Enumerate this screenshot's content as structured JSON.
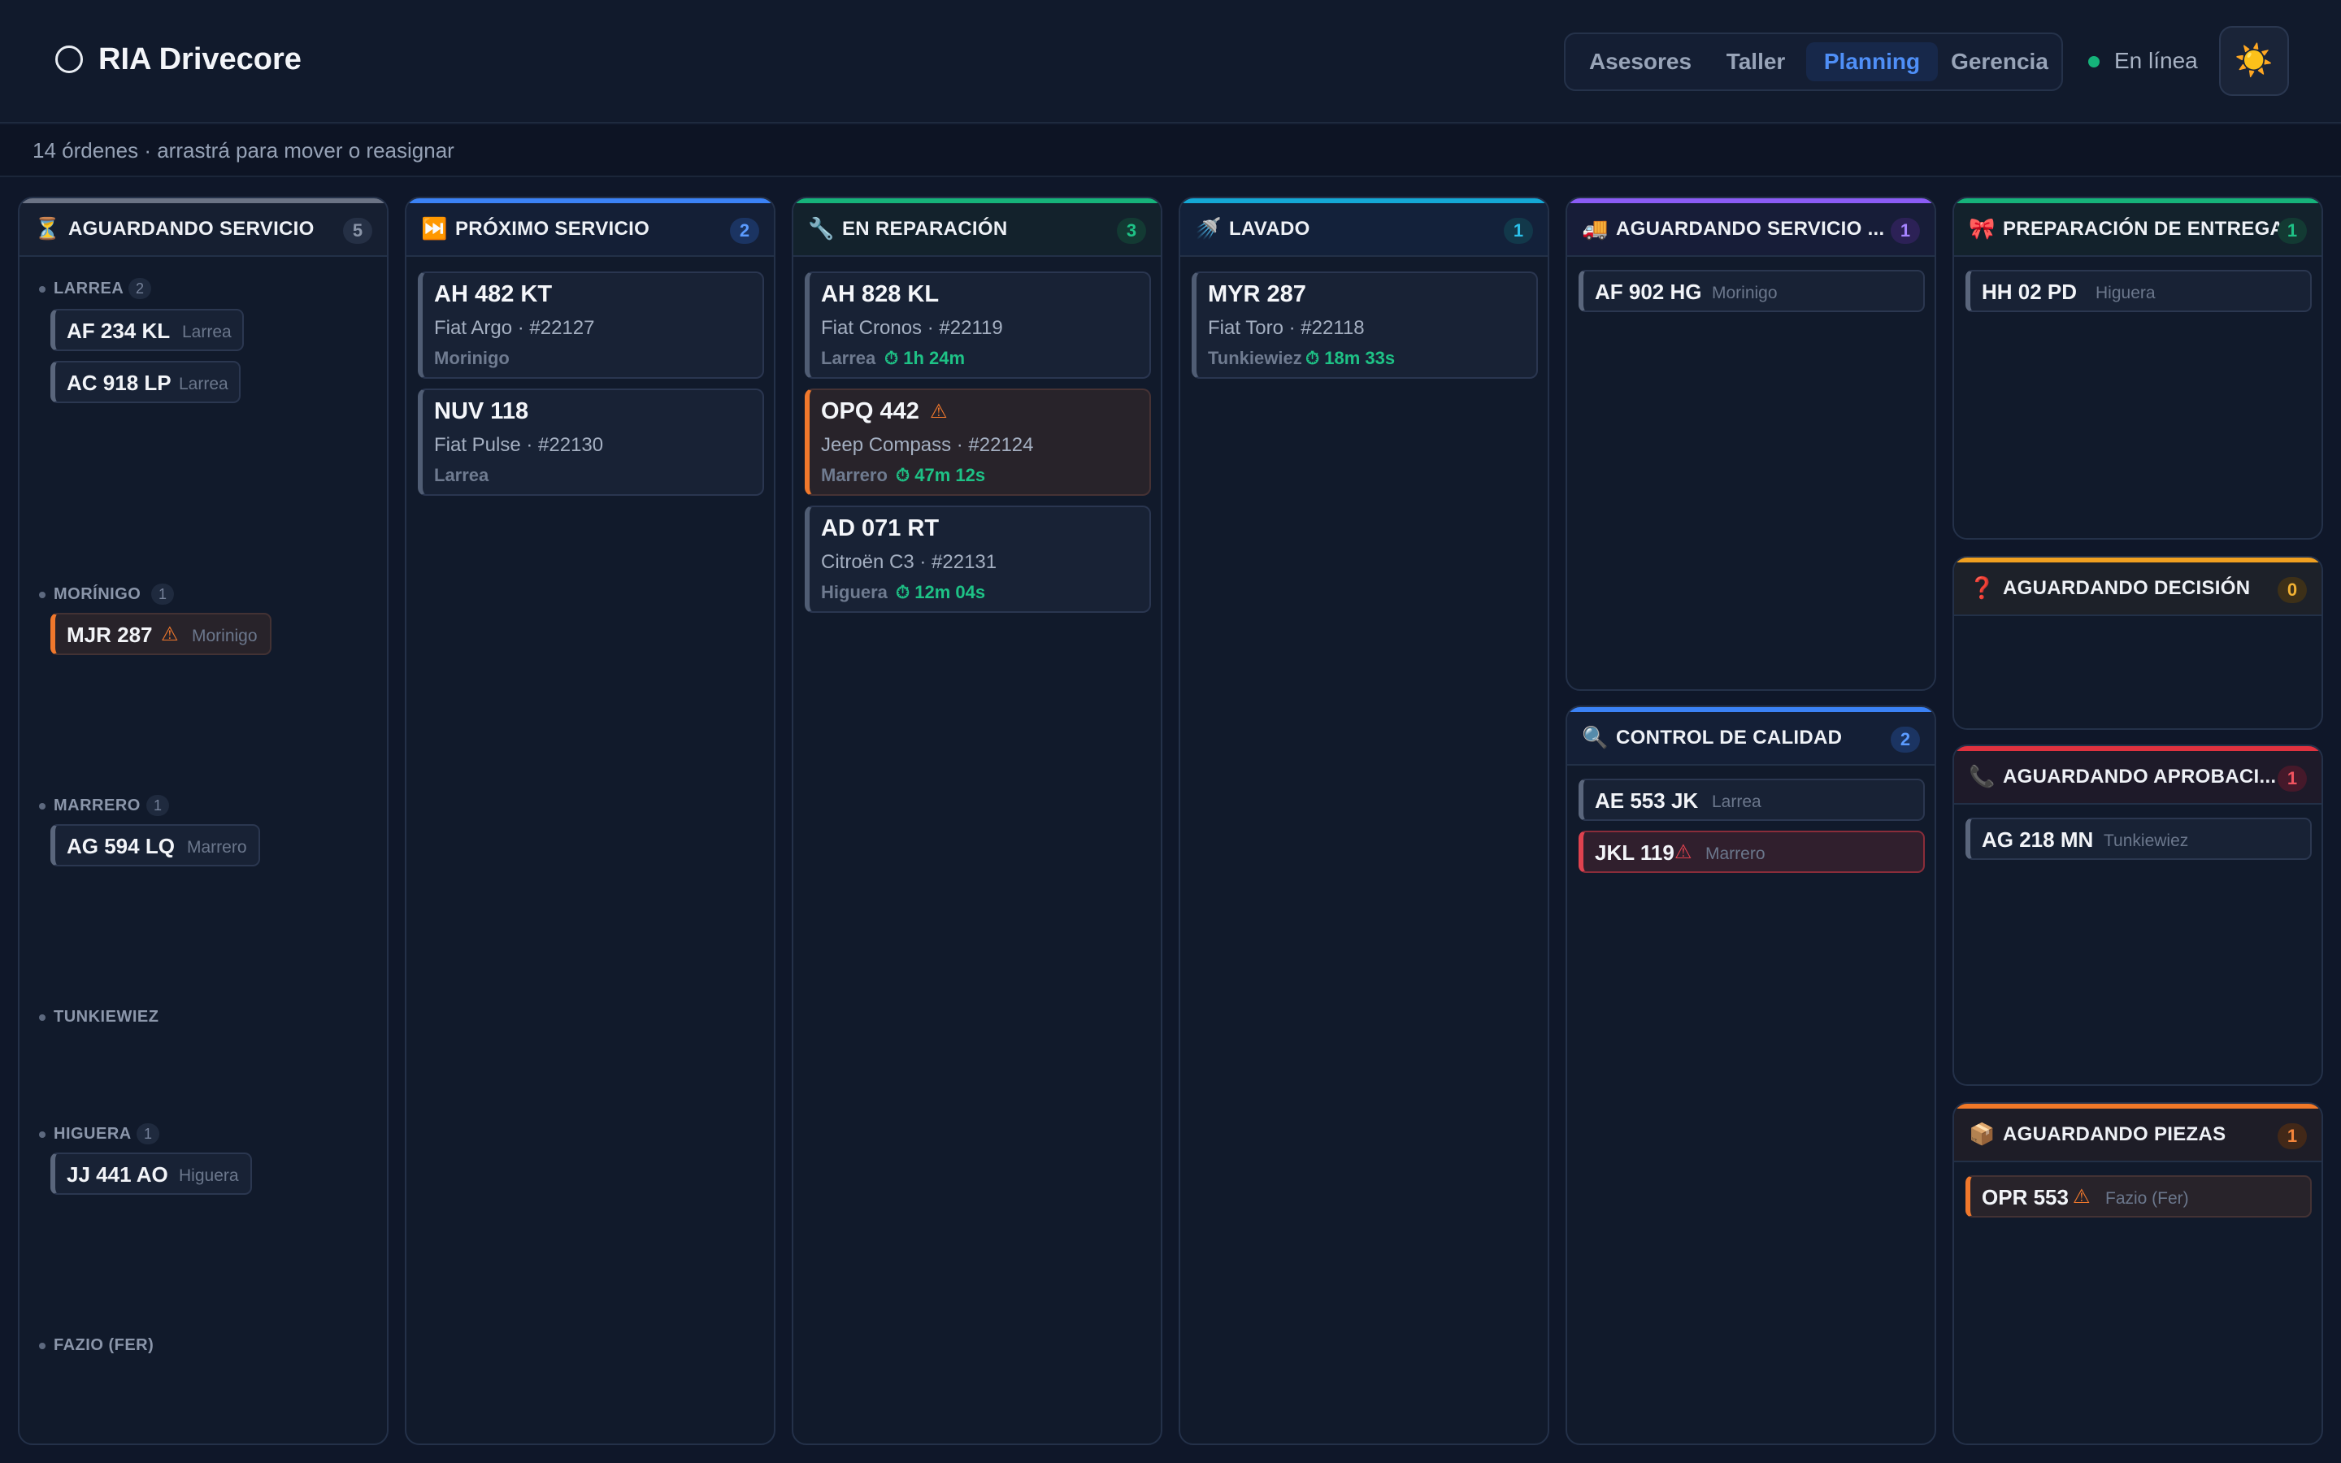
{
  "app": {
    "title": "RIA Drivecore"
  },
  "nav": {
    "tabs": [
      "Asesores",
      "Taller",
      "Planning",
      "Gerencia"
    ],
    "active": "Planning"
  },
  "status": {
    "label": "En línea",
    "color": "#15b37a"
  },
  "theme_toggle": {
    "icon": "☀️"
  },
  "subbar": {
    "text": "14 órdenes · arrastrá para mover o reasignar"
  },
  "columns": {
    "waiting": {
      "icon": "⏳",
      "title": "AGUARDANDO SERVICIO",
      "count": "5",
      "color": "#6b7385",
      "groups": [
        {
          "name": "LARREA",
          "count": "2",
          "chips": [
            {
              "plate": "AF 234 KL",
              "owner": "Larrea"
            },
            {
              "plate": "AC 918 LP",
              "owner": "Larrea"
            }
          ]
        },
        {
          "name": "MORÍNIGO",
          "count": "1",
          "chips": [
            {
              "plate": "MJR 287",
              "owner": "Morinigo",
              "warn": "⚠"
            }
          ]
        },
        {
          "name": "MARRERO",
          "count": "1",
          "chips": [
            {
              "plate": "AG 594 LQ",
              "owner": "Marrero"
            }
          ]
        },
        {
          "name": "TUNKIEWIEZ",
          "count": "",
          "chips": []
        },
        {
          "name": "HIGUERA",
          "count": "1",
          "chips": [
            {
              "plate": "JJ 441 AO",
              "owner": "Higuera"
            }
          ]
        },
        {
          "name": "FAZIO (FER)",
          "count": "",
          "chips": []
        }
      ]
    },
    "next": {
      "icon": "⏭️",
      "title": "PRÓXIMO SERVICIO",
      "count": "2",
      "color": "#3b82f6",
      "cards": [
        {
          "plate": "AH 482 KT",
          "model": "Fiat Argo · #22127",
          "advisor": "Morinigo"
        },
        {
          "plate": "NUV 118",
          "model": "Fiat Pulse · #22130",
          "advisor": "Larrea"
        }
      ]
    },
    "repair": {
      "icon": "🔧",
      "title": "EN REPARACIÓN",
      "count": "3",
      "color": "#16b37a",
      "cards": [
        {
          "plate": "AH 828 KL",
          "model": "Fiat Cronos · #22119",
          "advisor": "Larrea",
          "timer": "⏱ 1h 24m"
        },
        {
          "plate": "OPQ 442",
          "model": "Jeep Compass · #22124",
          "advisor": "Marrero",
          "timer": "⏱ 47m 12s",
          "warn": "⚠"
        },
        {
          "plate": "AD 071 RT",
          "model": "Citroën C3 · #22131",
          "advisor": "Higuera",
          "timer": "⏱ 12m 04s"
        }
      ]
    },
    "wash": {
      "icon": "🚿",
      "title": "LAVADO",
      "count": "1",
      "color": "#14a8d6",
      "cards": [
        {
          "plate": "MYR 287",
          "model": "Fiat Toro · #22118",
          "advisor": "Tunkiewiez",
          "timer": "⏱ 18m 33s"
        }
      ]
    },
    "waiting_ext": {
      "icon": "🚚",
      "title": "AGUARDANDO SERVICIO ...",
      "count": "1",
      "color": "#8b5cf6",
      "chips": [
        {
          "plate": "AF 902 HG",
          "owner": "Morinigo"
        }
      ]
    },
    "quality": {
      "icon": "🔍",
      "title": "CONTROL DE CALIDAD",
      "count": "2",
      "color": "#3b82f6",
      "chips": [
        {
          "plate": "AE 553 JK",
          "owner": "Larrea"
        },
        {
          "plate": "JKL 119",
          "owner": "Marrero",
          "danger": "⚠"
        }
      ]
    },
    "delivery": {
      "icon": "🎀",
      "title": "PREPARACIÓN DE ENTREGA",
      "count": "1",
      "color": "#16b37a",
      "chips": [
        {
          "plate": "HH 02 PD",
          "owner": "Higuera"
        }
      ]
    },
    "decision": {
      "icon": "❓",
      "title": "AGUARDANDO DECISIÓN",
      "count": "0",
      "color": "#f0a020",
      "chips": []
    },
    "approval": {
      "icon": "📞",
      "title": "AGUARDANDO APROBACI...",
      "count": "1",
      "color": "#e0323f",
      "chips": [
        {
          "plate": "AG 218 MN",
          "owner": "Tunkiewiez"
        }
      ]
    },
    "parts": {
      "icon": "📦",
      "title": "AGUARDANDO PIEZAS",
      "count": "1",
      "color": "#f07828",
      "chips": [
        {
          "plate": "OPR 553",
          "owner": "Fazio (Fer)",
          "warn": "⚠"
        }
      ]
    }
  }
}
